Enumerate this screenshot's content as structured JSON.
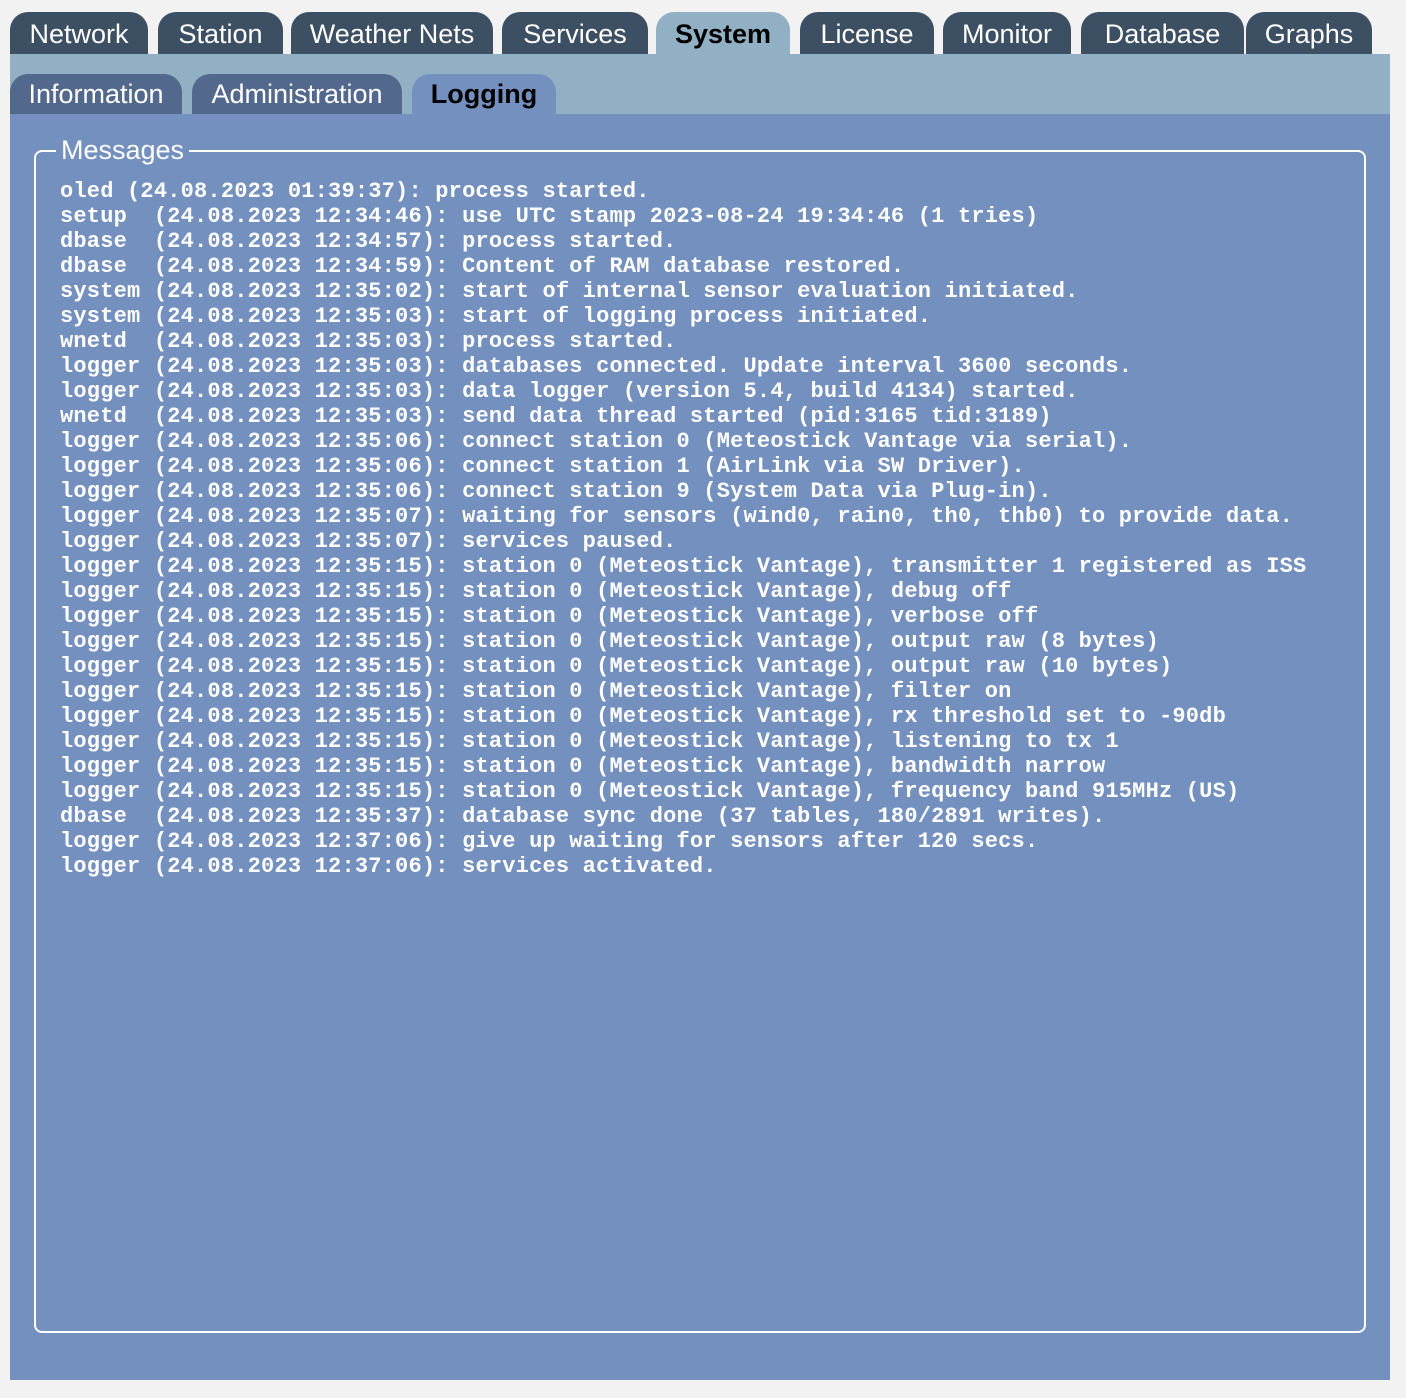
{
  "tabs": [
    {
      "id": "network",
      "label": "Network",
      "active": false
    },
    {
      "id": "station",
      "label": "Station",
      "active": false
    },
    {
      "id": "weather-nets",
      "label": "Weather Nets",
      "active": false
    },
    {
      "id": "services",
      "label": "Services",
      "active": false
    },
    {
      "id": "system",
      "label": "System",
      "active": true
    },
    {
      "id": "license",
      "label": "License",
      "active": false
    },
    {
      "id": "monitor",
      "label": "Monitor",
      "active": false
    },
    {
      "id": "database",
      "label": "Database",
      "active": false
    },
    {
      "id": "graphs",
      "label": "Graphs",
      "active": false
    }
  ],
  "subtabs": [
    {
      "id": "information",
      "label": "Information",
      "active": false
    },
    {
      "id": "administration",
      "label": "Administration",
      "active": false
    },
    {
      "id": "logging",
      "label": "Logging",
      "active": true
    }
  ],
  "messages": {
    "legend": "Messages",
    "lines": [
      "oled (24.08.2023 01:39:37): process started.",
      "setup  (24.08.2023 12:34:46): use UTC stamp 2023-08-24 19:34:46 (1 tries)",
      "dbase  (24.08.2023 12:34:57): process started.",
      "dbase  (24.08.2023 12:34:59): Content of RAM database restored.",
      "system (24.08.2023 12:35:02): start of internal sensor evaluation initiated.",
      "system (24.08.2023 12:35:03): start of logging process initiated.",
      "wnetd  (24.08.2023 12:35:03): process started.",
      "logger (24.08.2023 12:35:03): databases connected. Update interval 3600 seconds.",
      "logger (24.08.2023 12:35:03): data logger (version 5.4, build 4134) started.",
      "wnetd  (24.08.2023 12:35:03): send data thread started (pid:3165 tid:3189)",
      "logger (24.08.2023 12:35:06): connect station 0 (Meteostick Vantage via serial).",
      "logger (24.08.2023 12:35:06): connect station 1 (AirLink via SW Driver).",
      "logger (24.08.2023 12:35:06): connect station 9 (System Data via Plug-in).",
      "logger (24.08.2023 12:35:07): waiting for sensors (wind0, rain0, th0, thb0) to provide data.",
      "logger (24.08.2023 12:35:07): services paused.",
      "logger (24.08.2023 12:35:15): station 0 (Meteostick Vantage), transmitter 1 registered as ISS",
      "logger (24.08.2023 12:35:15): station 0 (Meteostick Vantage), debug off",
      "logger (24.08.2023 12:35:15): station 0 (Meteostick Vantage), verbose off",
      "logger (24.08.2023 12:35:15): station 0 (Meteostick Vantage), output raw (8 bytes)",
      "logger (24.08.2023 12:35:15): station 0 (Meteostick Vantage), output raw (10 bytes)",
      "logger (24.08.2023 12:35:15): station 0 (Meteostick Vantage), filter on",
      "logger (24.08.2023 12:35:15): station 0 (Meteostick Vantage), rx threshold set to -90db",
      "logger (24.08.2023 12:35:15): station 0 (Meteostick Vantage), listening to tx 1",
      "logger (24.08.2023 12:35:15): station 0 (Meteostick Vantage), bandwidth narrow",
      "logger (24.08.2023 12:35:15): station 0 (Meteostick Vantage), frequency band 915MHz (US)",
      "dbase  (24.08.2023 12:35:37): database sync done (37 tables, 180/2891 writes).",
      "logger (24.08.2023 12:37:06): give up waiting for sensors after 120 secs.",
      "logger (24.08.2023 12:37:06): services activated."
    ]
  },
  "colors": {
    "tab_background": "#3c4f63",
    "tab_active_background": "#91b0c4",
    "subtab_background": "#52688c",
    "content_background": "#7490bf",
    "text_light": "#ffffff",
    "text_active": "#000000"
  }
}
